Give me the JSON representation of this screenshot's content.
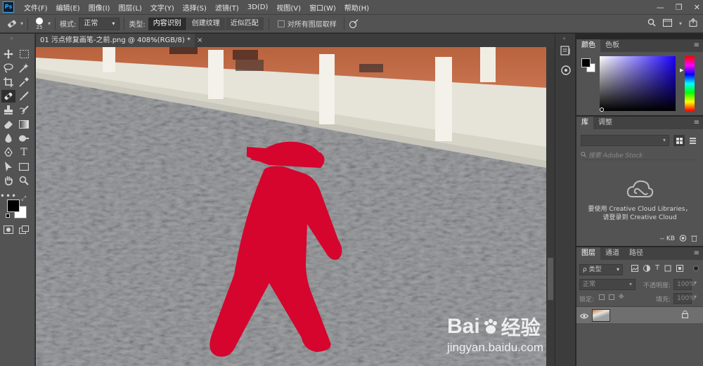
{
  "app": {
    "logo": "Ps"
  },
  "menu": [
    "文件(F)",
    "编辑(E)",
    "图像(I)",
    "图层(L)",
    "文字(Y)",
    "选择(S)",
    "滤镜(T)",
    "3D(D)",
    "视图(V)",
    "窗口(W)",
    "帮助(H)"
  ],
  "window_controls": {
    "minimize": "—",
    "restore": "❐",
    "close": "✕"
  },
  "options": {
    "brush_size": "25",
    "mode_label": "模式:",
    "mode_value": "正常",
    "type_label": "类型:",
    "type_buttons": [
      "内容识别",
      "创建纹理",
      "近似匹配"
    ],
    "sample_all_label": "对所有图层取样"
  },
  "document": {
    "tab_title": "01 污点修复画笔-之前.png @ 408%(RGB/8) *",
    "close": "×"
  },
  "color_panel": {
    "tabs": [
      "颜色",
      "色板"
    ],
    "foreground": "#000000",
    "background": "#ffffff"
  },
  "library_panel": {
    "tabs": [
      "库",
      "调整"
    ],
    "search_placeholder": "搜索 Adobe Stock",
    "message_line1": "要使用 Creative Cloud Libraries，",
    "message_line2": "请登录到 Creative Cloud",
    "size": "-- KB"
  },
  "layers_panel": {
    "tabs": [
      "图层",
      "通道",
      "路径"
    ],
    "filter_label": "ρ 类型",
    "blend_mode": "正常",
    "opacity_label": "不透明度:",
    "opacity_value": "100%",
    "lock_label": "锁定:",
    "fill_label": "填充:",
    "fill_value": "100%"
  },
  "watermark": {
    "brand": "Bai",
    "brand_cn": "经验",
    "url": "jingyan.baidu.com"
  },
  "colors": {
    "accent_red": "#d5052e",
    "ui_bg": "#535353",
    "dark_bg": "#282828"
  }
}
